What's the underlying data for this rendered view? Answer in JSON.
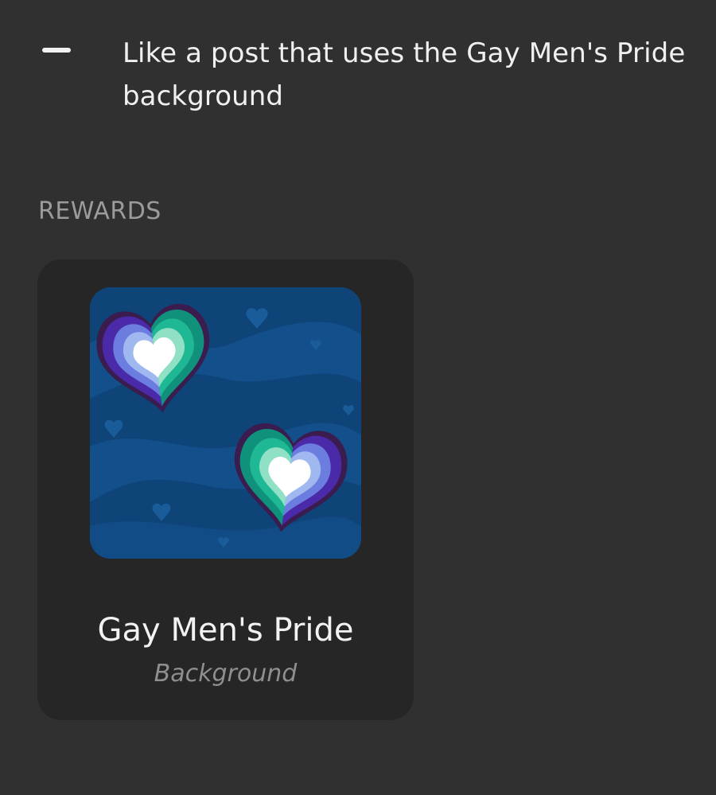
{
  "task": {
    "status_icon": "dash-icon",
    "text": "Like a post that uses the Gay Men's Pride background"
  },
  "rewards": {
    "section_label": "REWARDS",
    "items": [
      {
        "name": "Gay Men's Pride",
        "type": "Background",
        "thumbnail": "gay-mens-pride-hearts-image",
        "colors": {
          "background": "#0f4a7e",
          "wave": "#1a5c99",
          "teal": "#1fb894",
          "green": "#10917b",
          "mint": "#8fe0c4",
          "blue": "#6c7de0",
          "purple": "#4a2aa8",
          "lavender": "#9fb8f0"
        }
      }
    ]
  }
}
